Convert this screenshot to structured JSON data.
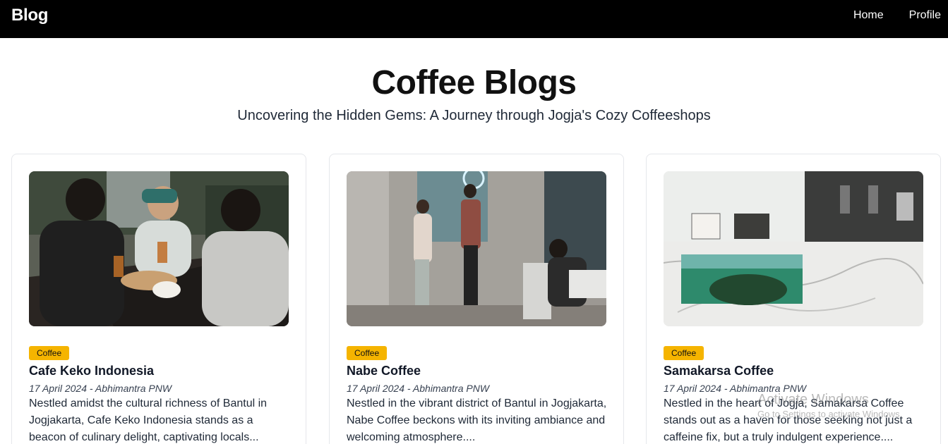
{
  "navbar": {
    "brand": "Blog",
    "links": [
      {
        "label": "Home"
      },
      {
        "label": "Profile"
      }
    ]
  },
  "hero": {
    "title": "Coffee Blogs",
    "subtitle": "Uncovering the Hidden Gems: A Journey through Jogja's Cozy Coffeeshops"
  },
  "cards": [
    {
      "category": "Coffee",
      "title": "Cafe Keko Indonesia",
      "meta": "17 April 2024 - Abhimantra PNW",
      "description": "Nestled amidst the cultural richness of Bantul in Jogjakarta, Cafe Keko Indonesia stands as a beacon of culinary delight, captivating locals..."
    },
    {
      "category": "Coffee",
      "title": "Nabe Coffee",
      "meta": "17 April 2024 - Abhimantra PNW",
      "description": "Nestled in the vibrant district of Bantul in Jogjakarta, Nabe Coffee beckons with its inviting ambiance and welcoming atmosphere...."
    },
    {
      "category": "Coffee",
      "title": "Samakarsa Coffee",
      "meta": "17 April 2024 - Abhimantra PNW",
      "description": "Nestled in the heart of Jogja, Samakarsa Coffee stands out as a haven for those seeking not just a caffeine fix, but a truly indulgent experience...."
    }
  ],
  "watermark": {
    "title": "Activate Windows",
    "subtitle": "Go to Settings to activate Windows."
  }
}
